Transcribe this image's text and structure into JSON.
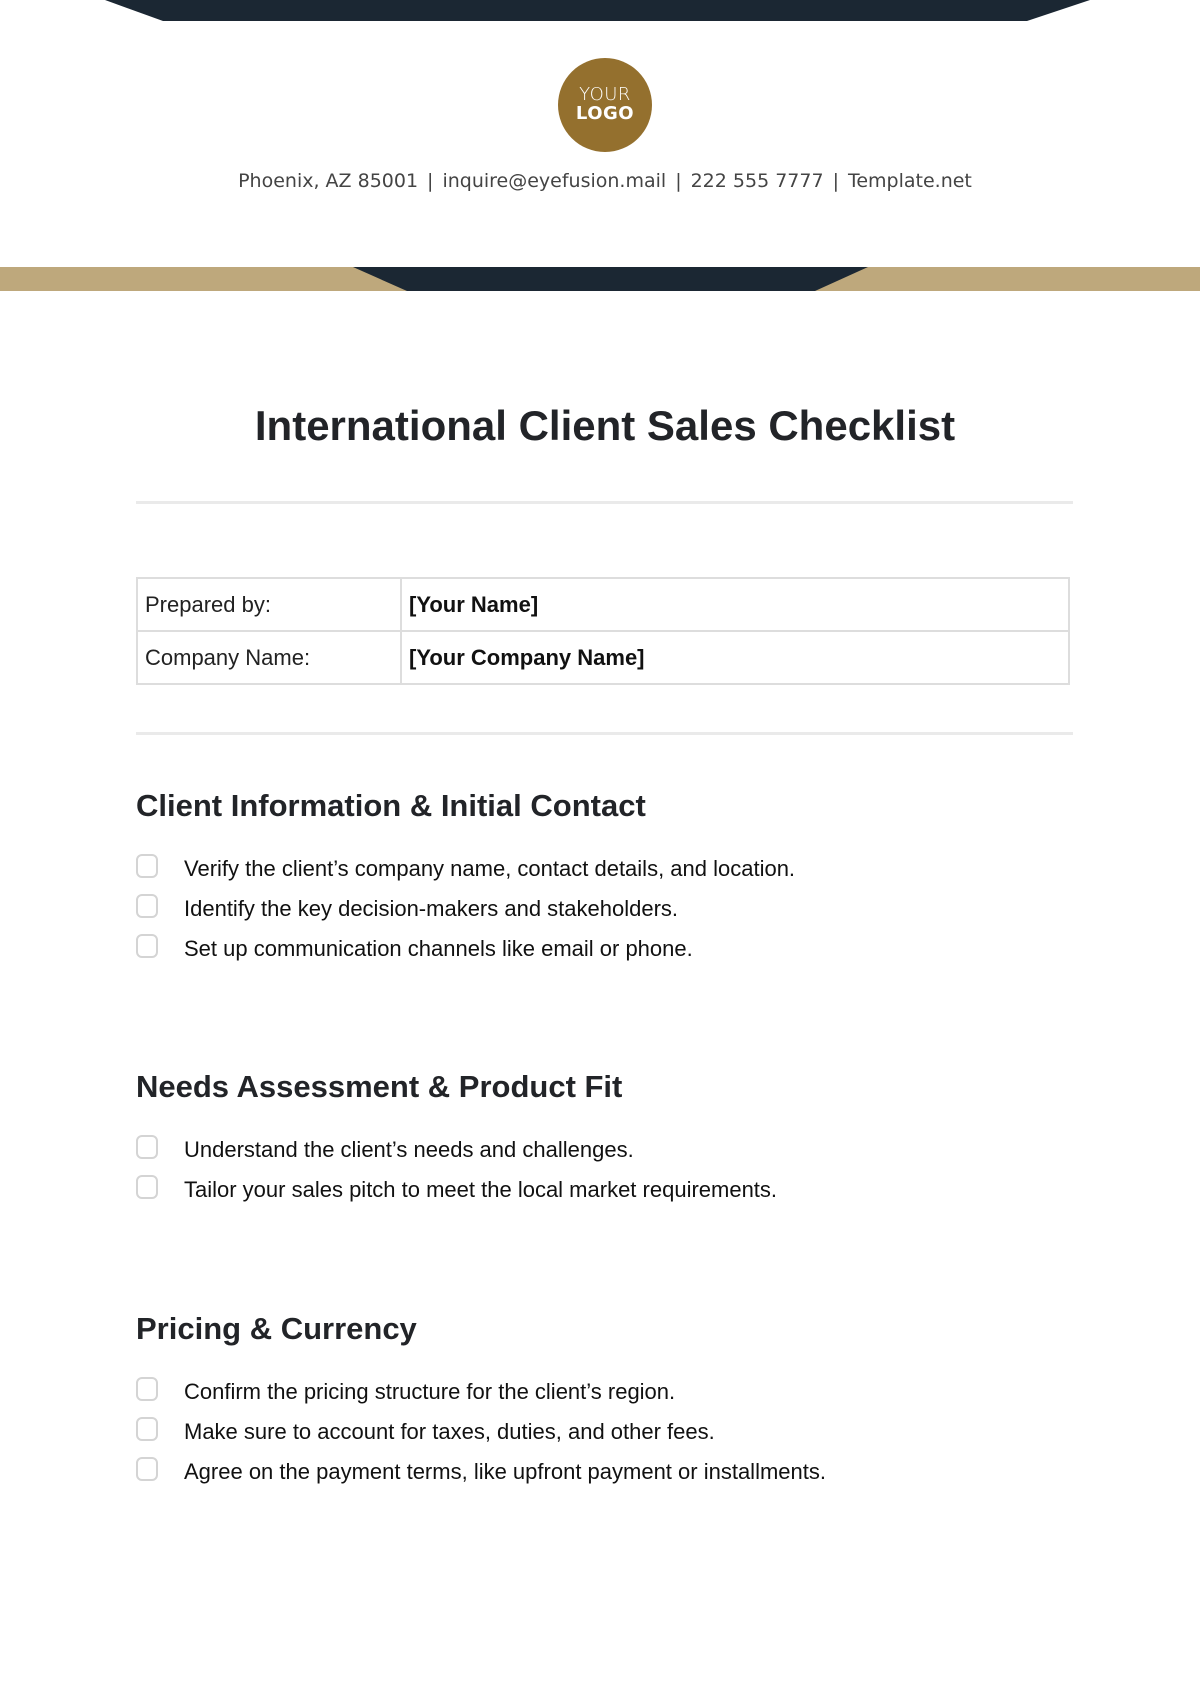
{
  "colors": {
    "navy": "#1b2733",
    "tan": "#bea87c",
    "logo_gold": "#94702e"
  },
  "header": {
    "logo": {
      "line1": "YOUR",
      "line2": "LOGO"
    },
    "contact": {
      "address": "Phoenix, AZ 85001",
      "email": "inquire@eyefusion.mail",
      "phone": "222 555 7777",
      "website": "Template.net",
      "separator": "|"
    }
  },
  "document": {
    "title": "International Client Sales Checklist",
    "meta": [
      {
        "label": "Prepared by:",
        "value": "[Your Name]"
      },
      {
        "label": "Company Name:",
        "value": "[Your Company Name]"
      }
    ],
    "sections": [
      {
        "heading": "Client Information & Initial Contact",
        "items": [
          {
            "text": "Verify the client’s company name, contact details, and location.",
            "checked": false
          },
          {
            "text": "Identify the key decision-makers and stakeholders.",
            "checked": false
          },
          {
            "text": "Set up communication channels like email or phone.",
            "checked": false
          }
        ]
      },
      {
        "heading": "Needs Assessment & Product Fit",
        "items": [
          {
            "text": "Understand the client’s needs and challenges.",
            "checked": false
          },
          {
            "text": "Tailor your sales pitch to meet the local market requirements.",
            "checked": false
          }
        ]
      },
      {
        "heading": "Pricing & Currency",
        "items": [
          {
            "text": "Confirm the pricing structure for the client’s region.",
            "checked": false
          },
          {
            "text": "Make sure to account for taxes, duties, and other fees.",
            "checked": false
          },
          {
            "text": "Agree on the payment terms, like upfront payment or installments.",
            "checked": false
          }
        ]
      }
    ]
  }
}
